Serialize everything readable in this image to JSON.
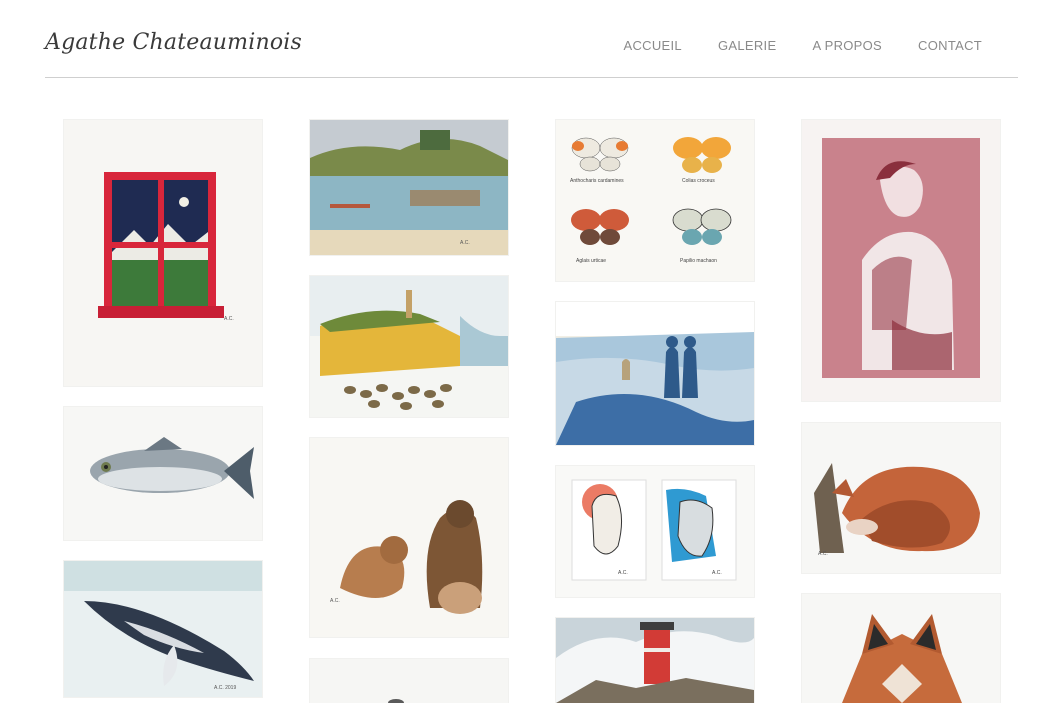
{
  "site": {
    "logo_text": "Agathe Chateauminois"
  },
  "nav": {
    "items": [
      {
        "label": "ACCUEIL"
      },
      {
        "label": "GALERIE"
      },
      {
        "label": "A PROPOS"
      },
      {
        "label": "CONTACT"
      }
    ]
  },
  "gallery": {
    "artworks": [
      {
        "name": "red-window-painting",
        "caption_left": "",
        "caption_right": ""
      },
      {
        "name": "fish-painting"
      },
      {
        "name": "whale-painting"
      },
      {
        "name": "harbor-painting"
      },
      {
        "name": "coast-cliff-painting"
      },
      {
        "name": "otters-painting"
      },
      {
        "name": "butterflies-painting",
        "labels": [
          "Anthocharis cardamines",
          "Colias croceus",
          "Aglais urticae",
          "Papilio machaon"
        ]
      },
      {
        "name": "beach-figures-painting"
      },
      {
        "name": "two-portraits-painting"
      },
      {
        "name": "lighthouse-painting"
      },
      {
        "name": "woman-portrait-painting"
      },
      {
        "name": "sleeping-fox-painting"
      },
      {
        "name": "fox-head-painting"
      },
      {
        "name": "partial-painting"
      }
    ]
  }
}
